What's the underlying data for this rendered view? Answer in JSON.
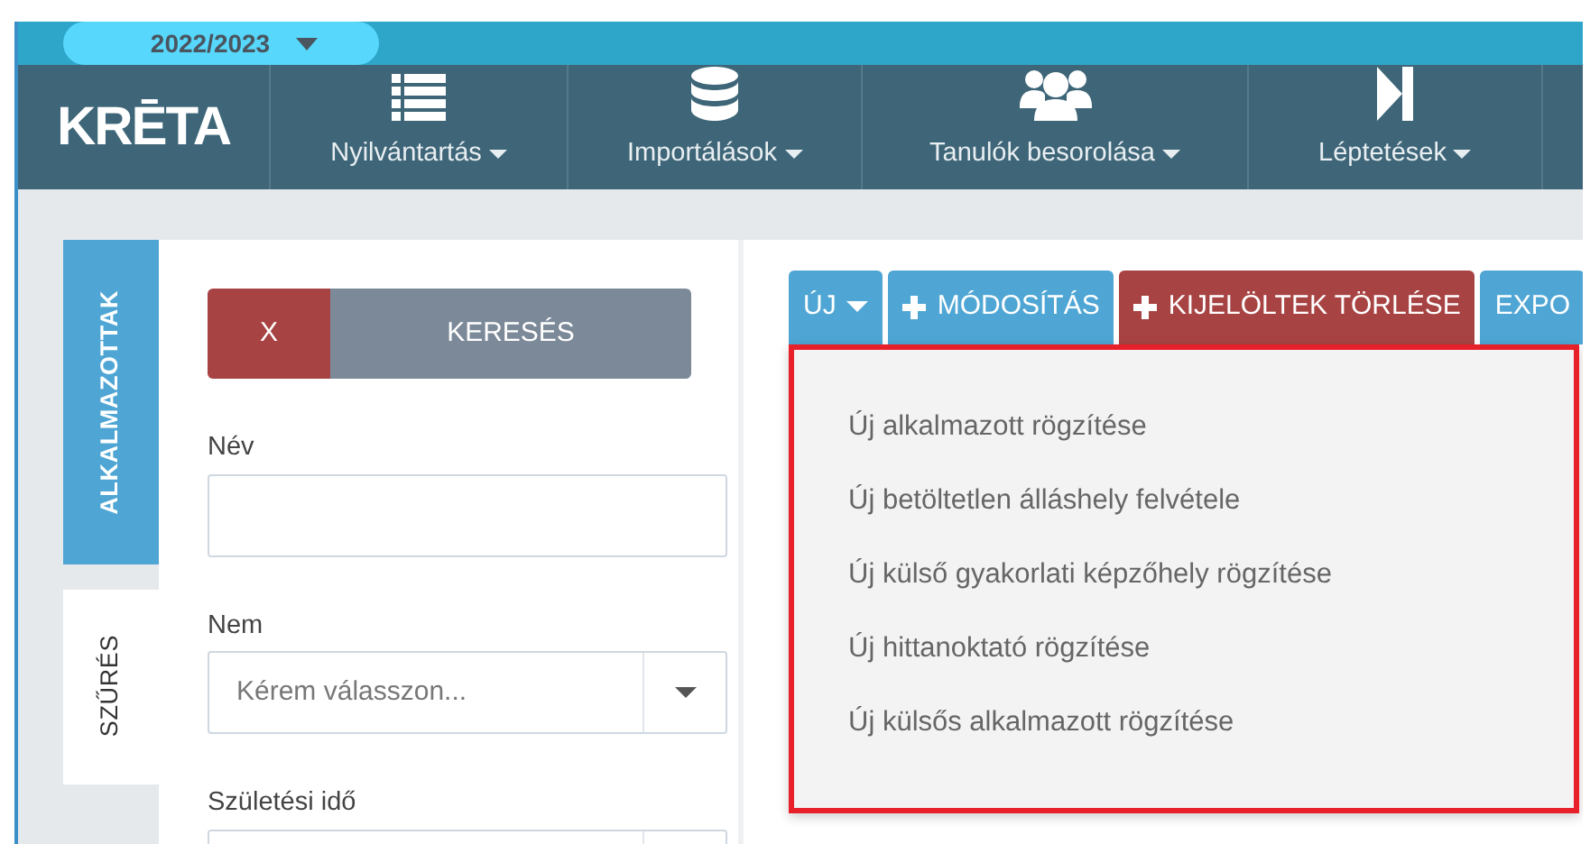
{
  "year_selector": {
    "value": "2022/2023"
  },
  "logo": {
    "text": "KRĒTA"
  },
  "nav": [
    {
      "kind": "list",
      "label": "Nyilvántartás"
    },
    {
      "kind": "database",
      "label": "Importálások"
    },
    {
      "kind": "users",
      "label": "Tanulók besorolása"
    },
    {
      "kind": "step",
      "label": "Léptetések"
    }
  ],
  "side_tabs": [
    {
      "label": "ALKALMAZOTTAK",
      "selected": false
    },
    {
      "label": "SZŰRÉS",
      "selected": true
    }
  ],
  "filter": {
    "clear_button": "X",
    "search_button": "KERESÉS",
    "fields": [
      {
        "kind": "text",
        "label": "Név"
      },
      {
        "kind": "select",
        "label": "Nem",
        "placeholder": "Kérem válasszon..."
      },
      {
        "kind": "date",
        "label": "Születési idő"
      }
    ]
  },
  "toolbar": [
    {
      "kind": "dropdown",
      "label": "ÚJ"
    },
    {
      "kind": "plus",
      "label": "MÓDOSÍTÁS"
    },
    {
      "kind": "danger",
      "label": "KIJELÖLTEK TÖRLÉSE"
    },
    {
      "kind": "plain",
      "label": "EXPO"
    }
  ],
  "dropdown_menu": [
    "Új alkalmazott rögzítése",
    "Új betöltetlen álláshely felvétele",
    "Új külső gyakorlati képzőhely rögzítése",
    "Új hittanoktató rögzítése",
    "Új külsős alkalmazott rögzítése"
  ]
}
